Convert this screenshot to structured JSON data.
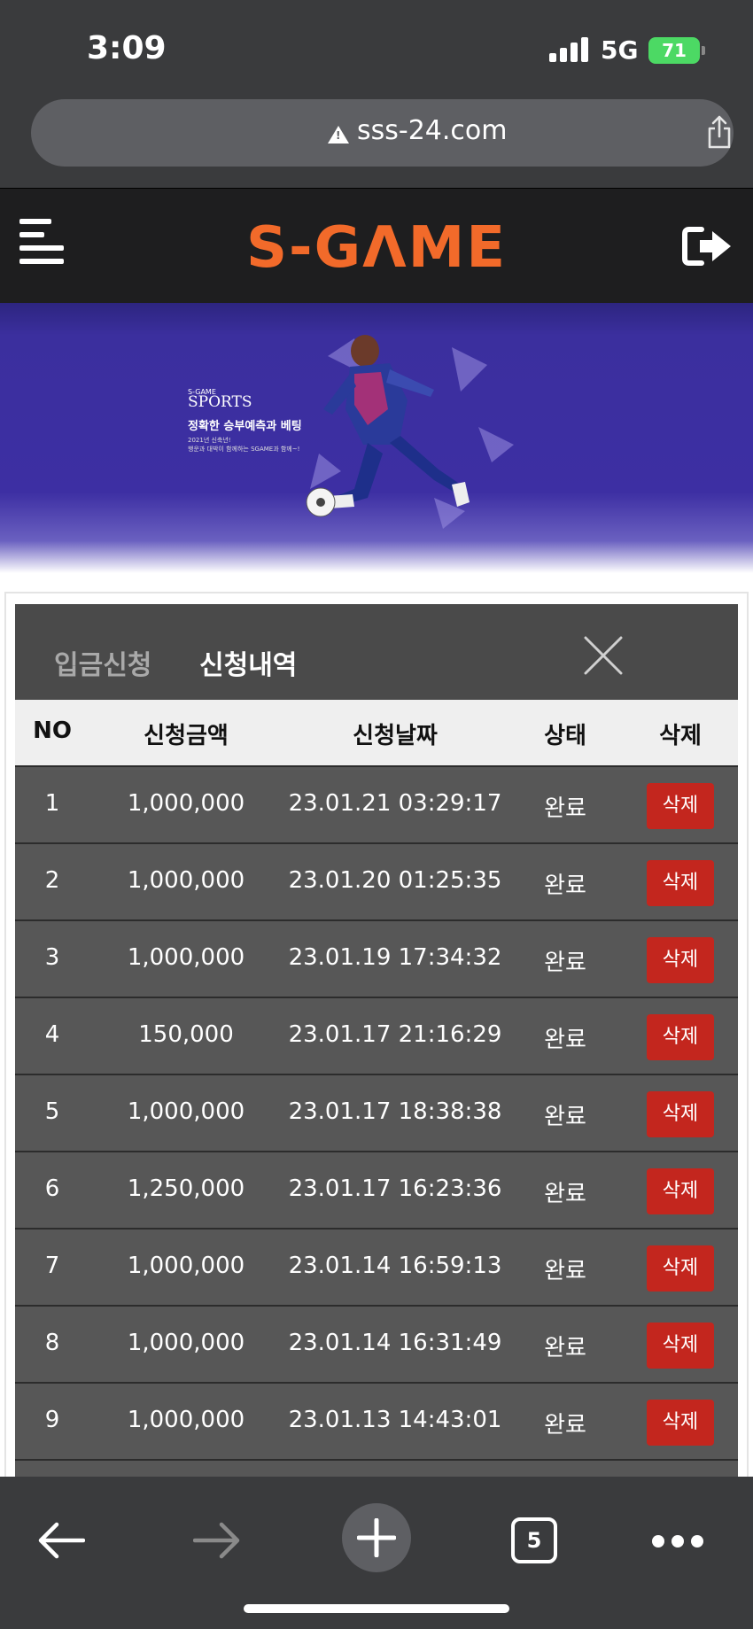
{
  "status_bar": {
    "time": "3:09",
    "network": "5G",
    "battery": "71"
  },
  "browser": {
    "url": "sss-24.com",
    "open_tabs": "5"
  },
  "site": {
    "logo": "S-GΛME"
  },
  "banner": {
    "brand": "S-GAME",
    "category": "SPORTS",
    "headline": "정확한 승부예측과 베팅",
    "sub1": "2021년 신축년!",
    "sub2": "행운과 대박이 함께하는 SGAME과 함께~!"
  },
  "modal": {
    "tabs": [
      "입금신청",
      "신청내역"
    ],
    "columns": [
      "NO",
      "신청금액",
      "신청날짜",
      "상태",
      "삭제"
    ],
    "rows": [
      {
        "no": "1",
        "amount": "1,000,000",
        "date": "23.01.21 03:29:17",
        "status": "완료",
        "action": "삭제"
      },
      {
        "no": "2",
        "amount": "1,000,000",
        "date": "23.01.20 01:25:35",
        "status": "완료",
        "action": "삭제"
      },
      {
        "no": "3",
        "amount": "1,000,000",
        "date": "23.01.19 17:34:32",
        "status": "완료",
        "action": "삭제"
      },
      {
        "no": "4",
        "amount": "150,000",
        "date": "23.01.17 21:16:29",
        "status": "완료",
        "action": "삭제"
      },
      {
        "no": "5",
        "amount": "1,000,000",
        "date": "23.01.17 18:38:38",
        "status": "완료",
        "action": "삭제"
      },
      {
        "no": "6",
        "amount": "1,250,000",
        "date": "23.01.17 16:23:36",
        "status": "완료",
        "action": "삭제"
      },
      {
        "no": "7",
        "amount": "1,000,000",
        "date": "23.01.14 16:59:13",
        "status": "완료",
        "action": "삭제"
      },
      {
        "no": "8",
        "amount": "1,000,000",
        "date": "23.01.14 16:31:49",
        "status": "완료",
        "action": "삭제"
      },
      {
        "no": "9",
        "amount": "1,000,000",
        "date": "23.01.13 14:43:01",
        "status": "완료",
        "action": "삭제"
      }
    ]
  },
  "icons": {
    "menu": "hamburger-icon",
    "logout": "logout-icon",
    "close": "close-icon",
    "back": "back-arrow-icon",
    "forward": "forward-arrow-icon",
    "new_tab": "plus-icon",
    "tabs": "tabs-icon",
    "more": "more-icon",
    "share": "share-icon",
    "warning": "warning-icon"
  },
  "colors": {
    "brand": "#f26a2a",
    "delete_button": "#c3261e",
    "banner": "#3d2fa3",
    "battery": "#4cd964"
  }
}
